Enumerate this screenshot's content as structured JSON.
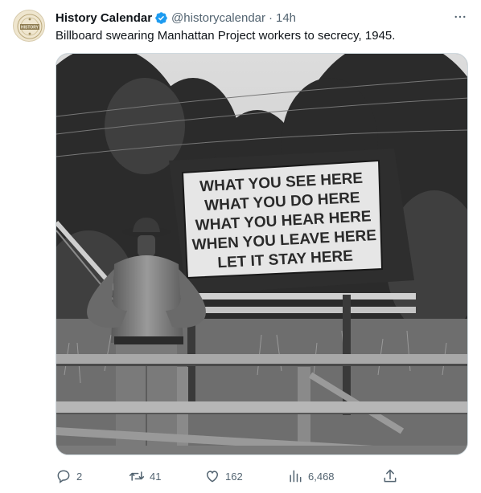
{
  "account": {
    "display_name": "History Calendar",
    "handle": "@historycalendar",
    "separator": "·",
    "time": "14h",
    "verified": true,
    "avatar_text": "HISTORY"
  },
  "tweet": {
    "text": "Billboard swearing Manhattan Project workers to secrecy, 1945."
  },
  "media": {
    "sign_lines": [
      "WHAT YOU SEE HERE",
      "WHAT YOU DO HERE",
      "WHAT YOU HEAR HERE",
      "WHEN YOU LEAVE HERE",
      "LET IT STAY HERE"
    ]
  },
  "actions": {
    "replies": "2",
    "retweets": "41",
    "likes": "162",
    "views": "6,468"
  },
  "icons": [
    "verified-badge-icon",
    "more-icon",
    "reply-icon",
    "retweet-icon",
    "like-icon",
    "views-icon",
    "share-icon"
  ],
  "colors": {
    "text": "#0f1419",
    "secondary": "#536471",
    "verified": "#1d9bf0",
    "border": "#cfd9de"
  }
}
